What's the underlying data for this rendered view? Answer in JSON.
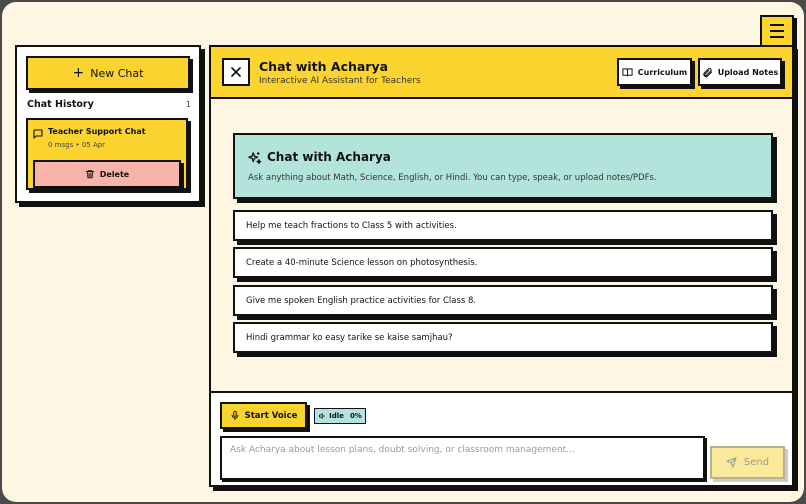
{
  "menu": {
    "icon": "hamburger-icon"
  },
  "sidebar": {
    "new_chat_label": "New Chat",
    "history_title": "Chat History",
    "history_count": "1",
    "chats": [
      {
        "title": "Teacher Support Chat",
        "meta": "0 msgs • 05 Apr",
        "delete_label": "Delete"
      }
    ]
  },
  "header": {
    "title": "Chat with Acharya",
    "subtitle": "Interactive AI Assistant for Teachers",
    "curriculum_label": "Curriculum",
    "upload_label": "Upload Notes"
  },
  "welcome": {
    "title": "Chat with Acharya",
    "body": "Ask anything about Math, Science, English, or Hindi. You can type, speak, or upload notes/PDFs."
  },
  "prompts": [
    "Help me teach fractions to Class 5 with activities.",
    "Create a 40-minute Science lesson on photosynthesis.",
    "Give me spoken English practice activities for Class 8.",
    "Hindi grammar ko easy tarike se kaise samjhau?"
  ],
  "composer": {
    "voice_label": "Start Voice",
    "status_label": "Idle",
    "status_level": "0%",
    "placeholder": "Ask Acharya about lesson plans, doubt solving, or classroom management...",
    "value": "",
    "send_label": "Send"
  },
  "colors": {
    "accent_yellow": "#fcd42f",
    "teal": "#b2e4dc",
    "delete_pink": "#f8b4a8",
    "background": "#fdf6e3"
  }
}
